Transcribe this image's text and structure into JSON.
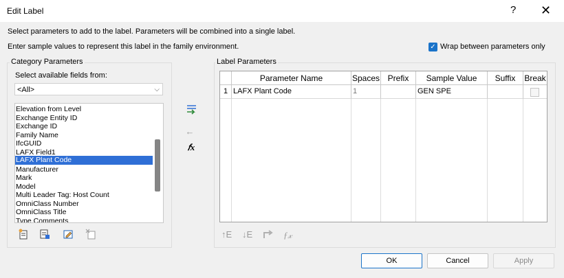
{
  "window": {
    "title": "Edit Label",
    "help_glyph": "?",
    "close_glyph": "✕"
  },
  "instructions": {
    "line1": "Select parameters to add to the label.  Parameters will be combined into a single label.",
    "line2": "Enter sample values to represent this label in the family environment."
  },
  "wrap_option": {
    "label": "Wrap between parameters only",
    "checked": true
  },
  "category": {
    "group_title": "Category Parameters",
    "select_label": "Select available fields from:",
    "select_value": "<All>",
    "fields": [
      "Elevation from Level",
      "Exchange Entity ID",
      "Exchange ID",
      "Family Name",
      "IfcGUID",
      "LAFX Field1",
      "LAFX Plant Code",
      "Manufacturer",
      "Mark",
      "Model",
      "Multi Leader Tag: Host Count",
      "OmniClass Number",
      "OmniClass Title",
      "Type Comments"
    ],
    "selected_field": "LAFX Plant Code",
    "tools": [
      "new-parameter-icon",
      "edit-parameter-icon",
      "edit-shared-icon",
      "delete-parameter-icon"
    ]
  },
  "middle_tools": {
    "add": "add-to-label-icon",
    "remove": "←",
    "formula": "𝑓x"
  },
  "label_params": {
    "group_title": "Label Parameters",
    "columns": [
      "Parameter Name",
      "Spaces",
      "Prefix",
      "Sample Value",
      "Suffix",
      "Break"
    ],
    "rows": [
      {
        "index": "1",
        "name": "LAFX Plant Code",
        "spaces": "1",
        "prefix": "",
        "sample": "GEN SPE",
        "suffix": "",
        "break": false
      }
    ],
    "bottom_tools": [
      "↑E",
      "↓E",
      "edit-icon",
      "ƒ𝓍"
    ]
  },
  "buttons": {
    "ok": "OK",
    "cancel": "Cancel",
    "apply": "Apply"
  },
  "colors": {
    "accent": "#1a73c9",
    "selection": "#2f6fd6"
  }
}
